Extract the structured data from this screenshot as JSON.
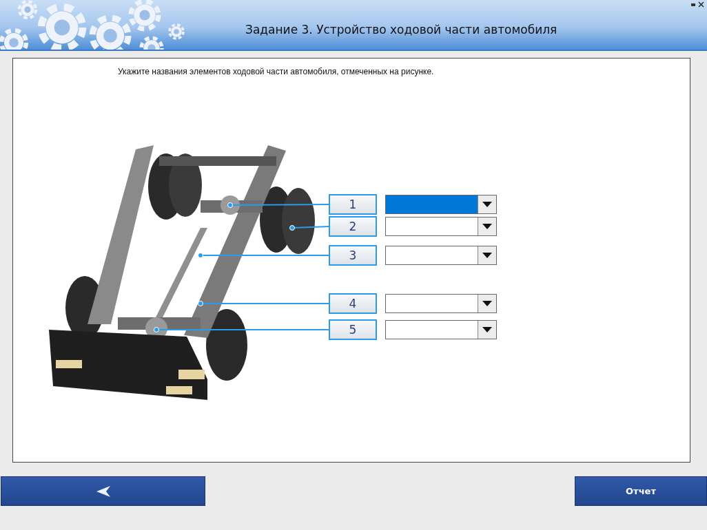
{
  "header": {
    "title": "Задание 3. Устройство ходовой части автомобиля"
  },
  "instruction": "Укажите названия элементов ходовой части автомобиля, отмеченных на рисунке.",
  "parts": [
    {
      "label": "1",
      "selected": true
    },
    {
      "label": "2",
      "selected": false
    },
    {
      "label": "3",
      "selected": false
    },
    {
      "label": "4",
      "selected": false
    },
    {
      "label": "5",
      "selected": false
    }
  ],
  "footer": {
    "report_button": "Отчет"
  }
}
